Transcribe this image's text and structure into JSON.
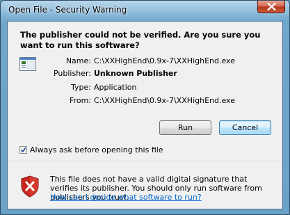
{
  "window": {
    "title": "Open File - Security Warning"
  },
  "header": {
    "warning": "The publisher could not be verified.  Are you sure you want to run this software?"
  },
  "details": [
    {
      "label": "Name:",
      "value": "C:\\XXHighEnd\\0.9x-7\\XXHighEnd.exe",
      "bold": false
    },
    {
      "label": "Publisher:",
      "value": "Unknown Publisher",
      "bold": true
    },
    {
      "label": "Type:",
      "value": "Application",
      "bold": false
    },
    {
      "label": "From:",
      "value": "C:\\XXHighEnd\\0.9x-7\\XXHighEnd.exe",
      "bold": false
    }
  ],
  "buttons": {
    "run": "Run",
    "cancel": "Cancel"
  },
  "checkbox": {
    "label": "Always ask before opening this file",
    "checked": true
  },
  "footer": {
    "text": "This file does not have a valid digital signature that verifies its publisher.  You should only run software from publishers you trust.",
    "link": "How can I decide what software to run?"
  },
  "icons": {
    "app": "application-icon",
    "shield": "security-shield-icon",
    "close": "close-icon",
    "check": "checkmark-icon"
  },
  "colors": {
    "link": "#0066cc",
    "shield_red": "#c8281e",
    "close_red": "#c7452c"
  }
}
